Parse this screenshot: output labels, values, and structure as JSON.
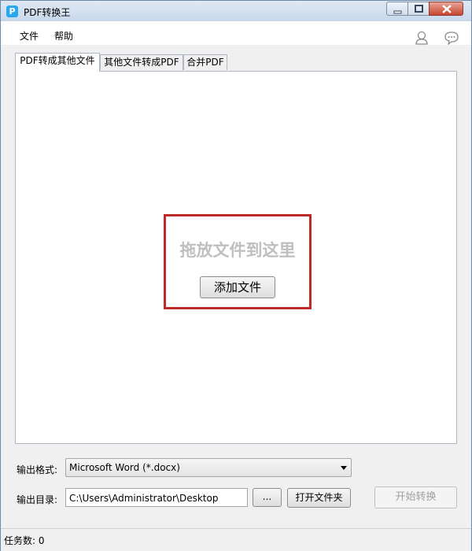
{
  "window": {
    "title": "PDF转换王",
    "icon": "app-logo-p"
  },
  "menu": {
    "file": "文件",
    "help": "帮助",
    "user_icon": "user-icon",
    "chat_icon": "chat-bubble-icon"
  },
  "tabs": [
    {
      "label": "PDF转成其他文件",
      "active": true
    },
    {
      "label": "其他文件转成PDF",
      "active": false
    },
    {
      "label": "合并PDF",
      "active": false
    }
  ],
  "dropzone": {
    "prompt": "拖放文件到这里",
    "add_button": "添加文件",
    "border_color": "#bd2a2a"
  },
  "output": {
    "format_label": "输出格式:",
    "format_value": "Microsoft Word (*.docx)",
    "dir_label": "输出目录:",
    "dir_value": "C:\\Users\\Administrator\\Desktop",
    "browse_button": "...",
    "open_folder_button": "打开文件夹",
    "start_button": "开始转换"
  },
  "status": {
    "task_count": "任务数: 0"
  }
}
